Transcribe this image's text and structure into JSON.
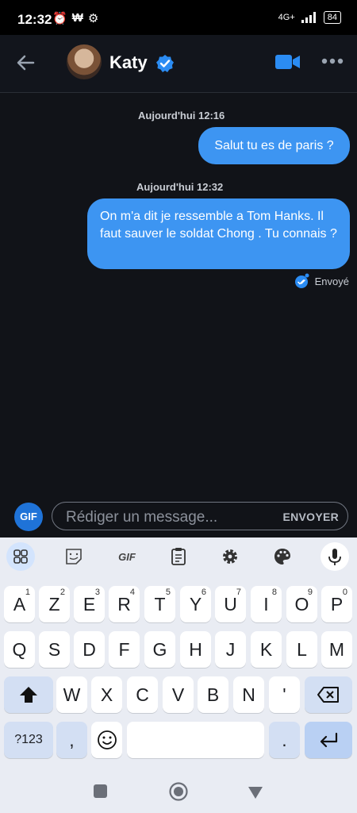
{
  "status_bar": {
    "time": "12:32",
    "network": "4G+",
    "battery": "84"
  },
  "header": {
    "contact_name": "Katy"
  },
  "messages": [
    {
      "timestamp": "Aujourd'hui 12:16",
      "text": "Salut tu es de paris ?"
    },
    {
      "timestamp": "Aujourd'hui 12:32",
      "text": "On m'a dit je ressemble a Tom Hanks. Il faut sauver le soldat Chong . Tu connais ?"
    }
  ],
  "delivery_status": "Envoyé",
  "composer": {
    "gif_label": "GIF",
    "placeholder": "Rédiger un message...",
    "send_label": "ENVOYER"
  },
  "keyboard": {
    "toolbar_gif": "GIF",
    "row1": [
      "A",
      "Z",
      "E",
      "R",
      "T",
      "Y",
      "U",
      "I",
      "O",
      "P"
    ],
    "row1_hints": [
      "1",
      "2",
      "3",
      "4",
      "5",
      "6",
      "7",
      "8",
      "9",
      "0"
    ],
    "row2": [
      "Q",
      "S",
      "D",
      "F",
      "G",
      "H",
      "J",
      "K",
      "L",
      "M"
    ],
    "row3": [
      "W",
      "X",
      "C",
      "V",
      "B",
      "N",
      "'"
    ],
    "symbols_label": "?123",
    "comma": ",",
    "period": "."
  }
}
